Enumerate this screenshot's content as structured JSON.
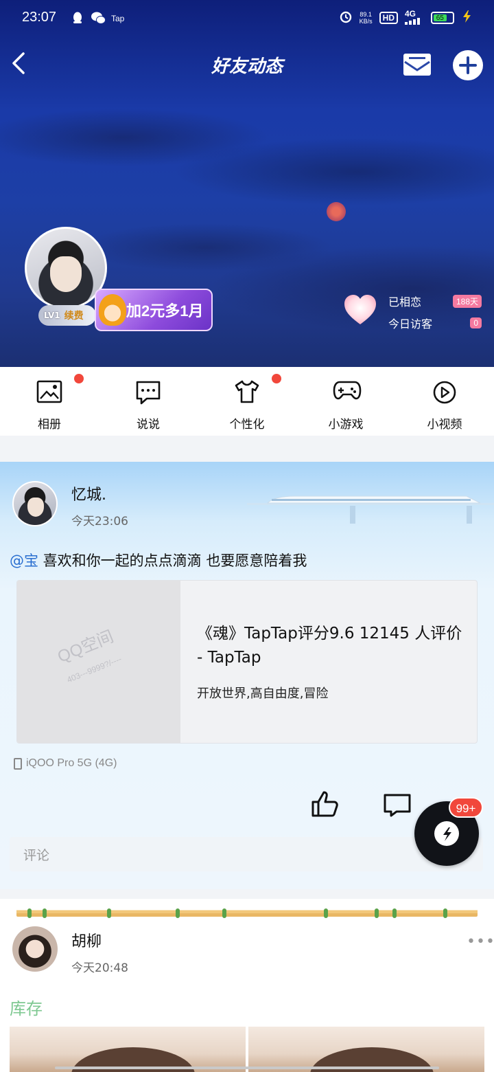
{
  "status_bar": {
    "time": "23:07",
    "tap_label": "Tap",
    "net_speed_value": "89.1",
    "net_speed_unit": "KB/s",
    "hd": "HD",
    "network": "4G",
    "battery": "65"
  },
  "header": {
    "title": "好友动态",
    "back_icon": "chevron-left-icon",
    "mail_icon": "mail-icon",
    "add_icon": "plus-icon"
  },
  "profile": {
    "level": "LV1",
    "renew_label": "续费",
    "promo_text": "加2元多1月",
    "love_label": "已相恋",
    "love_days": "188天",
    "visitors_label": "今日访客",
    "visitors_count": "0"
  },
  "features": [
    {
      "label": "相册",
      "icon": "album-icon",
      "dot": true
    },
    {
      "label": "说说",
      "icon": "chat-icon",
      "dot": false
    },
    {
      "label": "个性化",
      "icon": "shirt-icon",
      "dot": true
    },
    {
      "label": "小游戏",
      "icon": "gamepad-icon",
      "dot": false
    },
    {
      "label": "小视频",
      "icon": "play-icon",
      "dot": false
    }
  ],
  "post1": {
    "author": "忆城.",
    "time": "今天23:06",
    "mention": "@宝",
    "text": " 喜欢和你一起的点点滴滴 也要愿意陪着我",
    "link_title": "《魂》TapTap评分9.6 12145 人评价 - TapTap",
    "link_desc": "开放世界,高自由度,冒险",
    "watermark": "QQ空间",
    "watermark_sub": "403---9999?/----",
    "device": "iQOO Pro 5G (4G)",
    "comment_placeholder": "评论"
  },
  "fab": {
    "badge": "99+",
    "icon": "lightning-icon"
  },
  "post2": {
    "author": "胡柳",
    "time": "今天20:48",
    "more": "•••",
    "text": "库存"
  },
  "colors": {
    "accent_blue": "#2a6fd0",
    "red_dot": "#f1473b",
    "pink_pill": "#f47aa0",
    "green_text": "#7ec891"
  }
}
